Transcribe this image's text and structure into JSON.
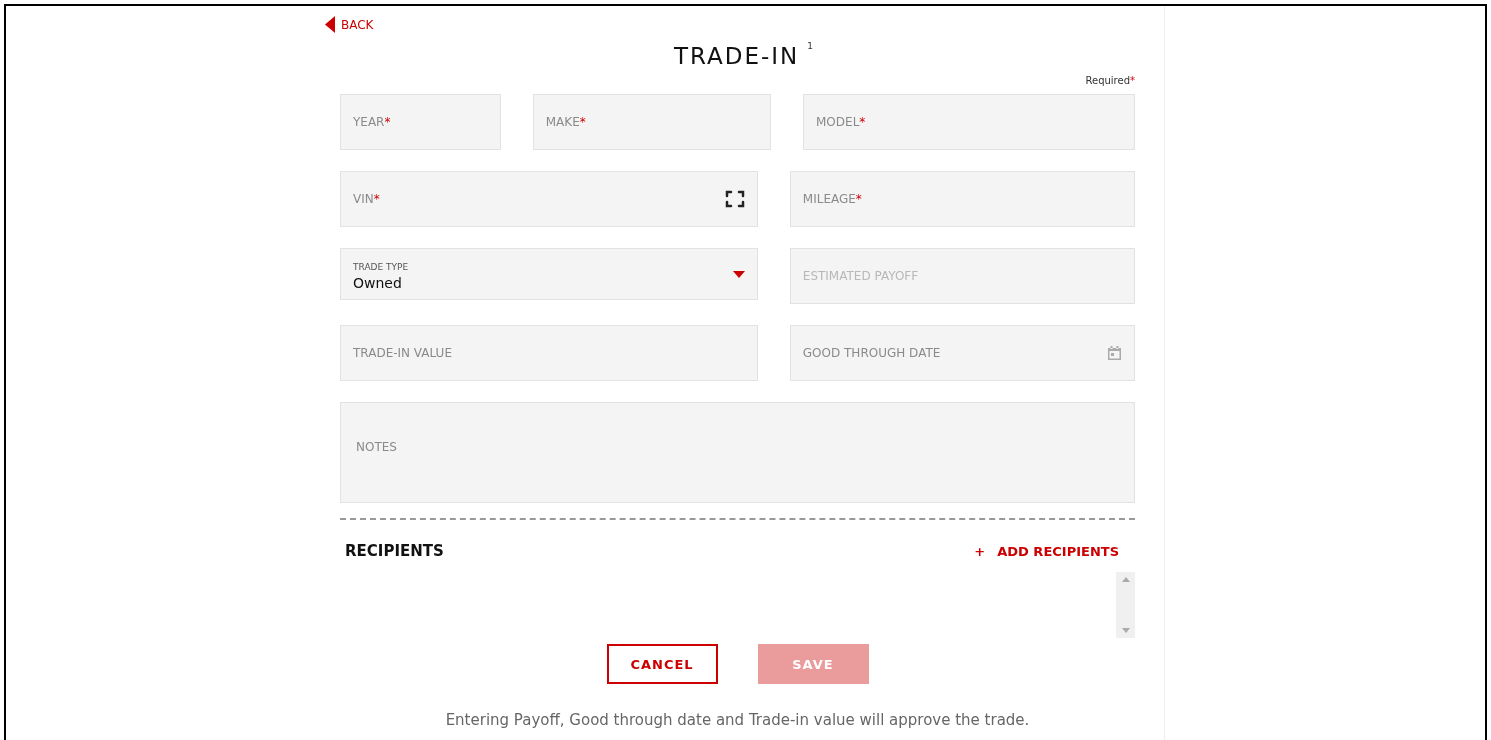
{
  "back": {
    "label": "BACK"
  },
  "title": "TRADE-IN",
  "title_note": "1",
  "required_note": "Required",
  "required_mark": "*",
  "field_rows": [
    [
      {
        "kind": "text",
        "label": "YEAR",
        "required": true,
        "disabled": false
      },
      {
        "kind": "text",
        "label": "MAKE",
        "required": true,
        "disabled": false
      },
      {
        "kind": "text",
        "label": "MODEL",
        "required": true,
        "disabled": false
      }
    ],
    [
      {
        "kind": "scan",
        "label": "VIN",
        "required": true,
        "disabled": false
      },
      {
        "kind": "text",
        "label": "MILEAGE",
        "required": true,
        "disabled": false
      }
    ],
    [
      {
        "kind": "select",
        "label": "TRADE TYPE",
        "value": "Owned",
        "required": false,
        "disabled": false
      },
      {
        "kind": "text",
        "label": "ESTIMATED PAYOFF",
        "required": false,
        "disabled": true
      }
    ],
    [
      {
        "kind": "text",
        "label": "TRADE-IN VALUE",
        "required": false,
        "disabled": false
      },
      {
        "kind": "date",
        "label": "GOOD THROUGH DATE",
        "required": false,
        "disabled": false
      }
    ],
    [
      {
        "kind": "textarea",
        "label": "NOTES",
        "required": false,
        "disabled": false
      }
    ]
  ],
  "recipients": {
    "heading": "RECIPIENTS",
    "add_label": "ADD RECIPIENTS",
    "add_icon": "+"
  },
  "buttons": [
    {
      "kind": "outline",
      "label": "CANCEL",
      "disabled": false
    },
    {
      "kind": "filled",
      "label": "SAVE",
      "disabled": true
    }
  ],
  "footer_note": "Entering Payoff, Good through date and Trade-in value will approve the trade."
}
